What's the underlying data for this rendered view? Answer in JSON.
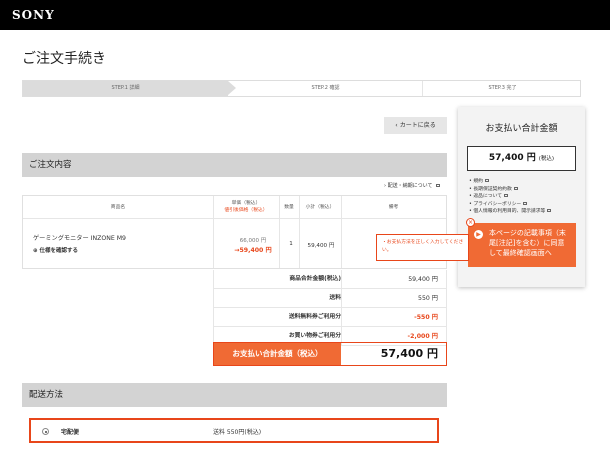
{
  "header": {
    "logo": "SONY"
  },
  "page_title": "ご注文手続き",
  "steps": [
    "STEP.1 詳細",
    "STEP.2 確認",
    "STEP.3 完了"
  ],
  "back_button": "カートに戻る",
  "order_section": {
    "title": "ご注文内容",
    "info_link": "配送・納期について",
    "headers": {
      "product": "商品名",
      "price": "単価（税込）",
      "price_sub": "値引後価格（税込）",
      "qty": "数量",
      "subtotal": "小計（税込）",
      "remarks": "備考"
    },
    "item": {
      "name": "ゲーミングモニター INZONE M9",
      "spec_link": "仕様を確認する",
      "old_price": "66,000 円",
      "new_price": "→59,400 円",
      "qty": "1",
      "subtotal": "59,400 円"
    },
    "summary": [
      {
        "label": "商品合計金額(税込)",
        "value": "59,400 円",
        "negative": false
      },
      {
        "label": "送料",
        "value": "550 円",
        "negative": false
      },
      {
        "label": "送料無料券ご利用分",
        "value": "-550 円",
        "negative": true
      },
      {
        "label": "お買い物券ご利用分",
        "value": "-2,000 円",
        "negative": true
      }
    ],
    "total": {
      "label": "お支払い合計金額（税込）",
      "value": "57,400 円"
    }
  },
  "delivery_section": {
    "title": "配送方法",
    "option_name": "宅配便",
    "option_fee": "送料 550円(税込)"
  },
  "side_panel": {
    "title": "お支払い合計金額",
    "amount": "57,400 円",
    "tax_note": "(税込)",
    "links": [
      "規約",
      "長期保証契約約款",
      "返品について",
      "プライバシーポリシー",
      "個人情報の利用目的、開示請求等"
    ],
    "confirm_text": "本ページの記載事項（末尾[注記]を含む）に同意して最終確認画面へ",
    "confirm_icon": "▶"
  },
  "error_popup": {
    "text": "・お支払方法を正しく入力してください。",
    "close": "×"
  },
  "colors": {
    "accent": "#f06a34",
    "header_bg": "#000000",
    "section_bg": "#d3d3d3"
  }
}
